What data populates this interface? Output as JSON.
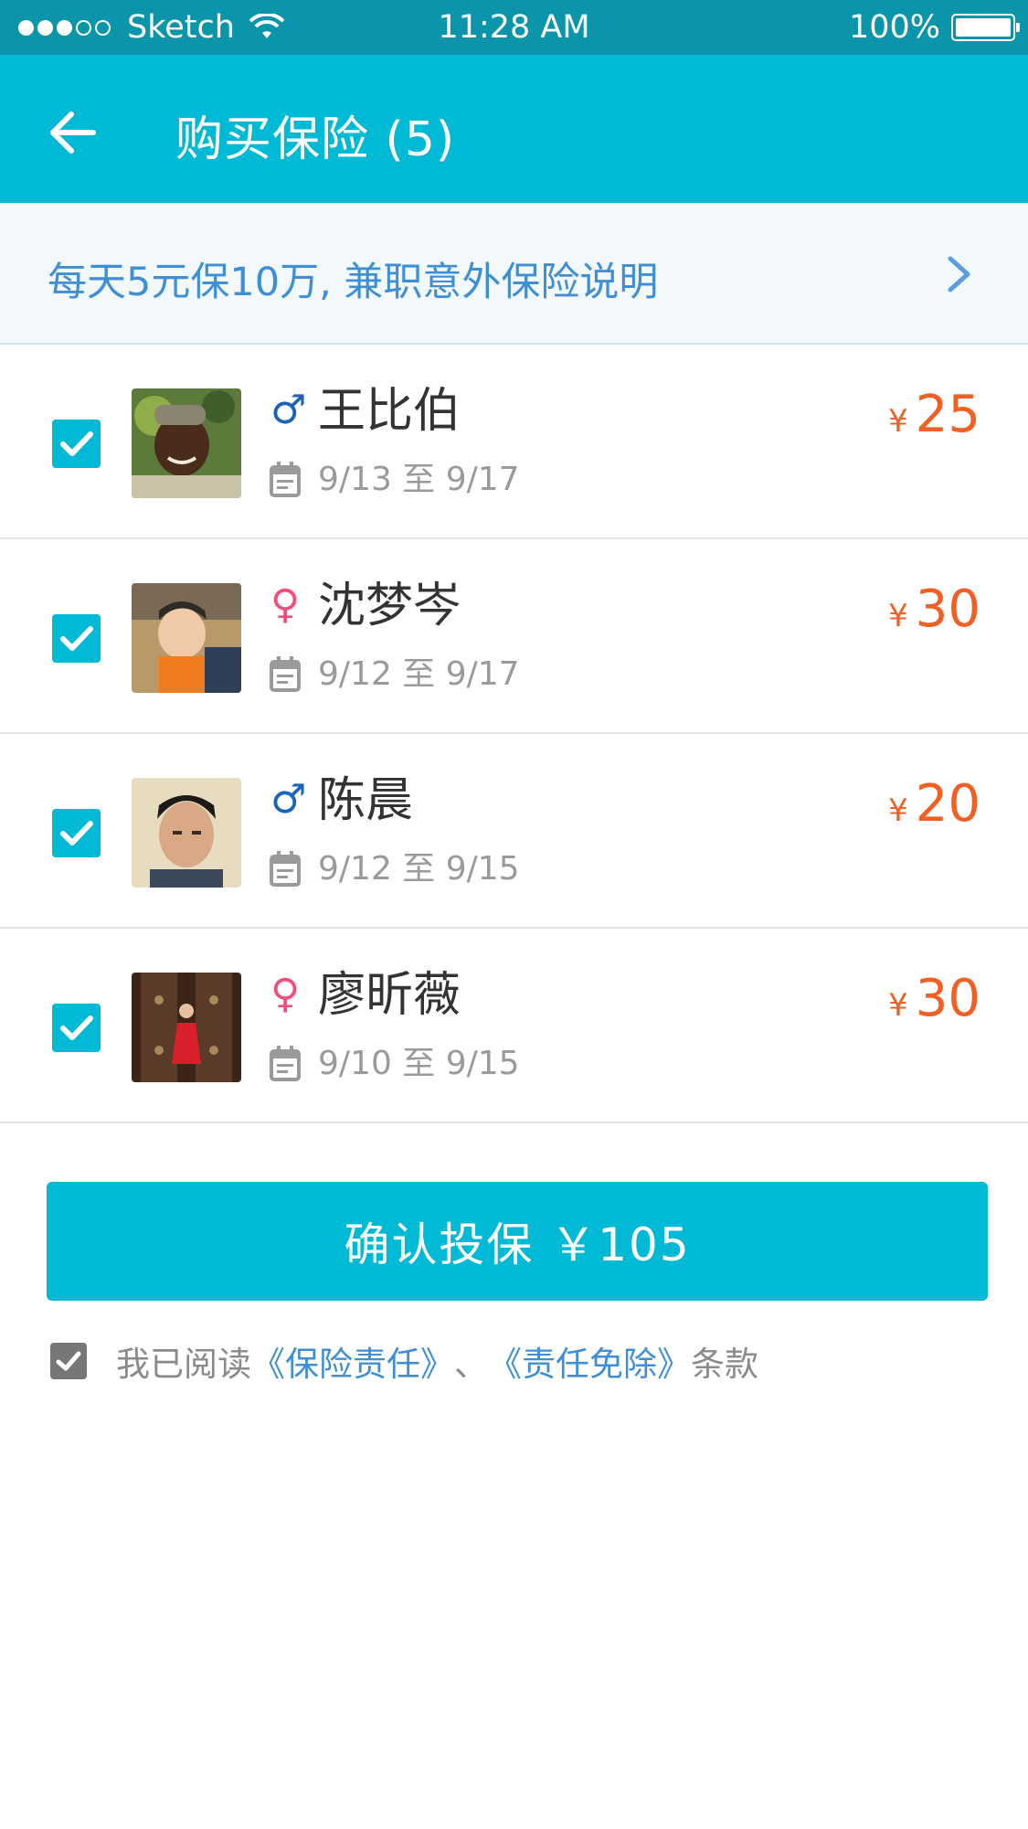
{
  "status_bar": {
    "carrier": "Sketch",
    "time": "11:28 AM",
    "battery": "100%"
  },
  "header": {
    "title": "购买保险 (5)",
    "back_icon": "arrow-left-icon"
  },
  "notice": {
    "text": "每天5元保10万, 兼职意外保险说明",
    "chevron_icon": "chevron-right-icon"
  },
  "people": [
    {
      "gender_symbol": "♂",
      "gender": "male",
      "name": "王比伯",
      "dates": "9/13 至 9/17",
      "currency": "¥",
      "price": "25"
    },
    {
      "gender_symbol": "♀",
      "gender": "female",
      "name": "沈梦岑",
      "dates": "9/12 至 9/17",
      "currency": "¥",
      "price": "30"
    },
    {
      "gender_symbol": "♂",
      "gender": "male",
      "name": "陈晨",
      "dates": "9/12 至 9/15",
      "currency": "¥",
      "price": "20"
    },
    {
      "gender_symbol": "♀",
      "gender": "female",
      "name": "廖昕薇",
      "dates": "9/10 至 9/15",
      "currency": "¥",
      "price": "30"
    }
  ],
  "confirm": {
    "label": "确认投保 ￥105"
  },
  "agreement": {
    "prefix": "我已阅读",
    "link1": "《保险责任》",
    "separator": "、",
    "link2": "《责任免除》",
    "suffix": "条款"
  },
  "colors": {
    "primary": "#00b9d5",
    "status_bar": "#0a95ab",
    "price": "#f25f25",
    "link": "#3f8fd6",
    "male": "#1a63b8",
    "female": "#ef4f7a"
  }
}
